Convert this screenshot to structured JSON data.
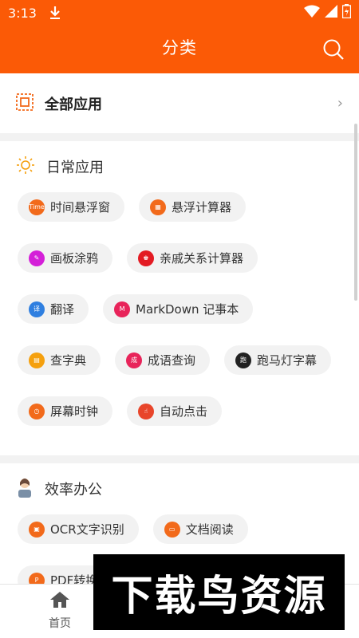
{
  "status": {
    "time": "3:13"
  },
  "header": {
    "title": "分类"
  },
  "all_apps": {
    "label": "全部应用",
    "chevron": "›"
  },
  "sections": [
    {
      "title": "日常应用",
      "icon": "sun-icon"
    },
    {
      "title": "效率办公",
      "icon": "office-worker-icon"
    }
  ],
  "daily": [
    {
      "label": "时间悬浮窗",
      "color": "#f26a1b",
      "icon": "time-float-icon",
      "glyph": "Time"
    },
    {
      "label": "悬浮计算器",
      "color": "#f26a1b",
      "icon": "calculator-icon",
      "glyph": "▦"
    },
    {
      "label": "画板涂鸦",
      "color": "#d41fd8",
      "icon": "drawing-board-icon",
      "glyph": "✎"
    },
    {
      "label": "亲戚关系计算器",
      "color": "#e31b23",
      "icon": "relatives-icon",
      "glyph": "♚"
    },
    {
      "label": "翻译",
      "color": "#2f7fe0",
      "icon": "translate-icon",
      "glyph": "译"
    },
    {
      "label": "MarkDown 记事本",
      "color": "#e8245a",
      "icon": "markdown-icon",
      "glyph": "M"
    },
    {
      "label": "查字典",
      "color": "#f5a00e",
      "icon": "dictionary-icon",
      "glyph": "▤"
    },
    {
      "label": "成语查询",
      "color": "#e8245a",
      "icon": "idiom-icon",
      "glyph": "成"
    },
    {
      "label": "跑马灯字幕",
      "color": "#222222",
      "icon": "marquee-icon",
      "glyph": "跑"
    },
    {
      "label": "屏幕时钟",
      "color": "#f26a1b",
      "icon": "clock-icon",
      "glyph": "◷"
    },
    {
      "label": "自动点击",
      "color": "#e8452a",
      "icon": "auto-click-icon",
      "glyph": "☝"
    }
  ],
  "office": [
    {
      "label": "OCR文字识别",
      "color": "#f26a1b",
      "icon": "ocr-icon",
      "glyph": "▣"
    },
    {
      "label": "文档阅读",
      "color": "#f26a1b",
      "icon": "document-icon",
      "glyph": "▭"
    },
    {
      "label": "PDF转换",
      "color": "#f26a1b",
      "icon": "pdf-icon",
      "glyph": "P"
    }
  ],
  "nav": {
    "home_label": "首页"
  },
  "watermark": {
    "text": "下载鸟资源"
  },
  "colors": {
    "brand": "#fb5a06"
  }
}
